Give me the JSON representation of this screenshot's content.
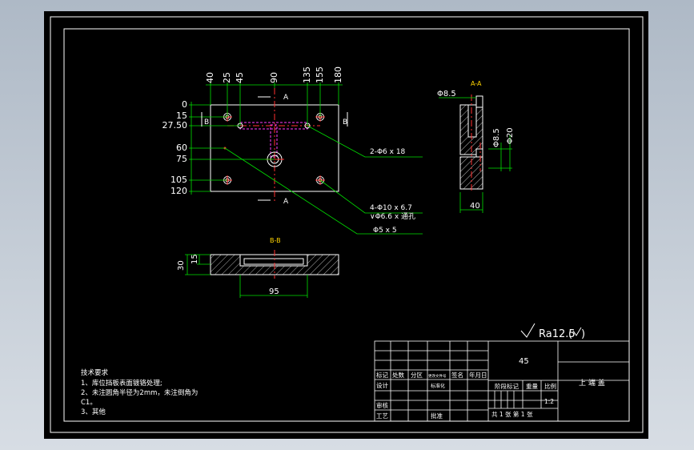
{
  "drawing": {
    "top_dims": {
      "x": [
        "40",
        "25",
        "45",
        "90",
        "135",
        "155",
        "180"
      ],
      "y": [
        "0",
        "15",
        "27.50",
        "60",
        "75",
        "105",
        "120"
      ]
    },
    "section_marks": {
      "a": "A",
      "b": "B"
    },
    "callouts": {
      "hole_c": "2-Φ6 x 18",
      "hole_d": "4-Φ10 x 6.7",
      "hole_d2": "∨Φ6.6 x 通孔",
      "hole_e": "Φ5 x 5"
    },
    "section_aa": {
      "title": "A-A",
      "d_top": "Φ8.5",
      "d_right1": "Φ8.5",
      "d_right2": "Φ20",
      "width": "40"
    },
    "section_bb": {
      "title": "B-B",
      "h_outer": "30",
      "h_inner": "15",
      "width": "95"
    },
    "roughness": "Ra12.5",
    "tech_req": {
      "title": "技术要求",
      "items": [
        "1、库位挡板表面镀铬处理;",
        "2、未注圆角半径为2mm，未注倒角为",
        "C1。",
        "3、其他"
      ]
    },
    "title_block": {
      "material": "45",
      "part_name": "上 端 盖",
      "headers": [
        "标记",
        "处数",
        "分区",
        "更改文件号",
        "签名",
        "年月日"
      ],
      "rows": [
        "设计",
        "标准化",
        "审核",
        "工艺",
        "批准"
      ],
      "stage_label": "阶段标记",
      "weight_label": "重量",
      "scale_label": "比例",
      "scale": "1:2",
      "sheet": "共 1 张  第 1 张"
    }
  }
}
